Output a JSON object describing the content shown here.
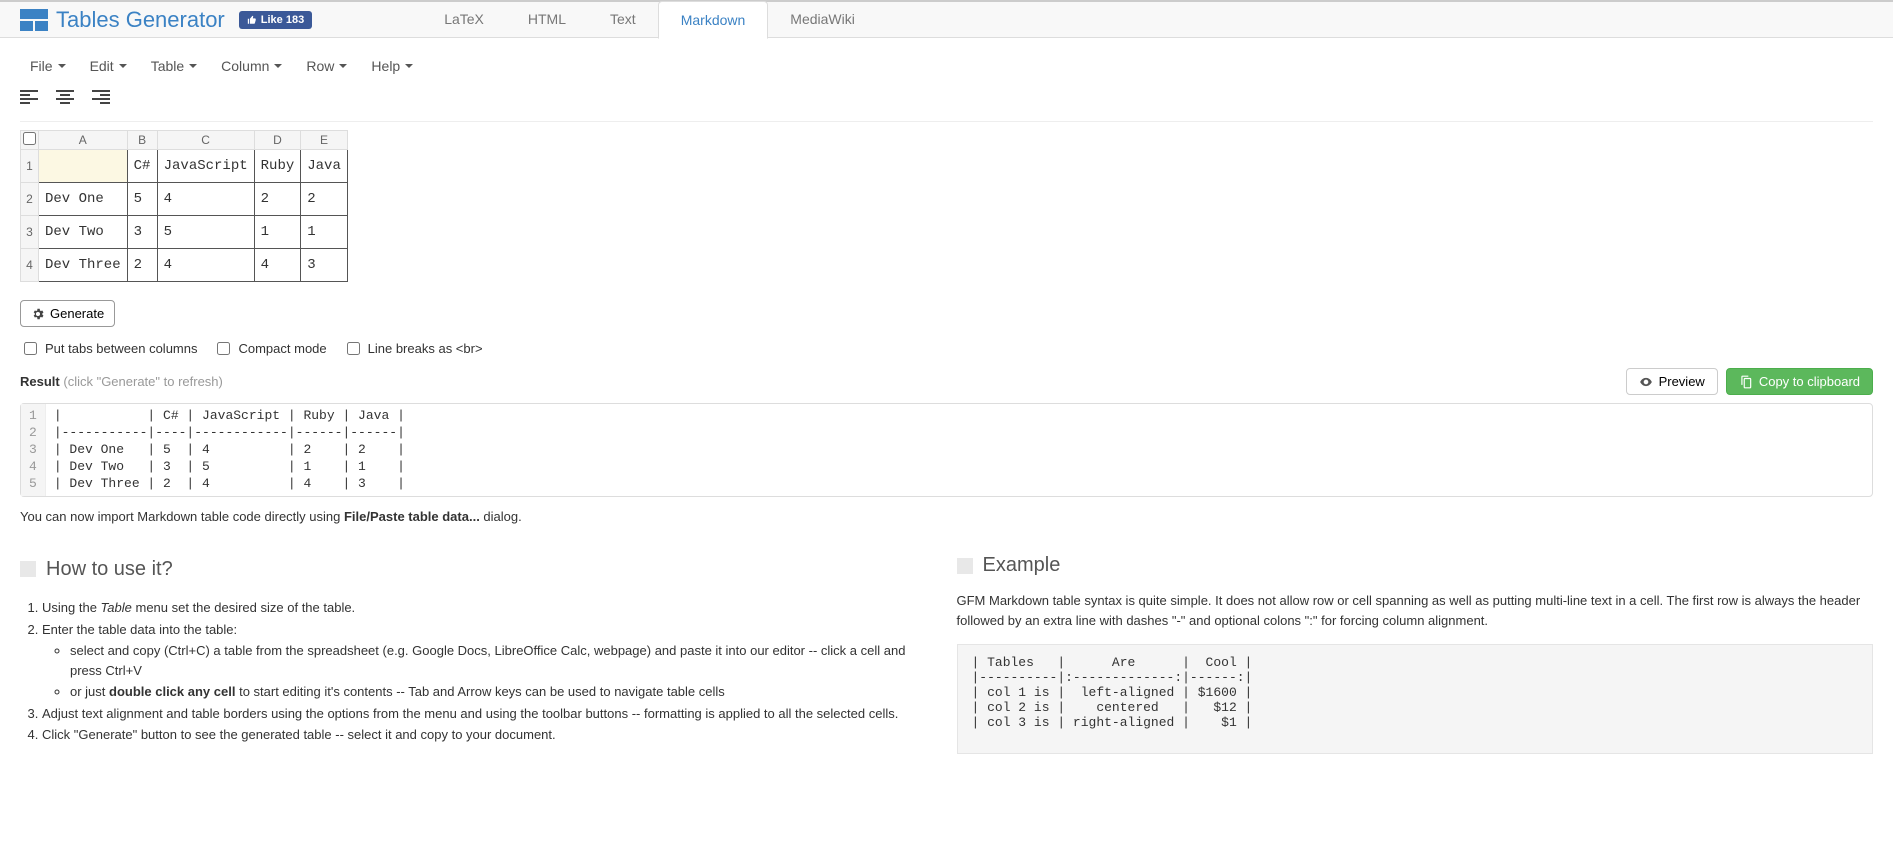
{
  "logo_text": "Tables Generator",
  "fb_like": "Like 183",
  "tabs": [
    "LaTeX",
    "HTML",
    "Text",
    "Markdown",
    "MediaWiki"
  ],
  "tab_active": 3,
  "menus": [
    "File",
    "Edit",
    "Table",
    "Column",
    "Row",
    "Help"
  ],
  "grid": {
    "cols": [
      "A",
      "B",
      "C",
      "D",
      "E"
    ],
    "rows": [
      "1",
      "2",
      "3",
      "4"
    ],
    "cells": [
      [
        "",
        "C#",
        "JavaScript",
        "Ruby",
        "Java"
      ],
      [
        "Dev One",
        "5",
        "4",
        "2",
        "2"
      ],
      [
        "Dev Two",
        "3",
        "5",
        "1",
        "1"
      ],
      [
        "Dev Three",
        "2",
        "4",
        "4",
        "3"
      ]
    ],
    "selected": [
      0,
      0
    ]
  },
  "generate_label": "Generate",
  "opts": {
    "tabs_label": "Put tabs between columns",
    "compact_label": "Compact mode",
    "br_label": "Line breaks as <br>"
  },
  "result": {
    "label": "Result",
    "hint": "(click \"Generate\" to refresh)",
    "preview": "Preview",
    "copy": "Copy to clipboard"
  },
  "code_lines": [
    "|           | C# | JavaScript | Ruby | Java |",
    "|-----------|----|------------|------|------|",
    "| Dev One   | 5  | 4          | 2    | 2    |",
    "| Dev Two   | 3  | 5          | 1    | 1    |",
    "| Dev Three | 2  | 4          | 4    | 3    |"
  ],
  "import_prefix": "You can now import Markdown table code directly using ",
  "import_bold": "File/Paste table data...",
  "import_suffix": " dialog.",
  "howto_heading": "How to use it?",
  "howto": {
    "li1_a": "Using the ",
    "li1_em": "Table",
    "li1_b": " menu set the desired size of the table.",
    "li2": "Enter the table data into the table:",
    "li2a": "select and copy (Ctrl+C) a table from the spreadsheet (e.g. Google Docs, LibreOffice Calc, webpage) and paste it into our editor -- click a cell and press Ctrl+V",
    "li2b_a": "or just ",
    "li2b_bold": "double click any cell",
    "li2b_b": " to start editing it's contents -- Tab and Arrow keys can be used to navigate table cells",
    "li3": "Adjust text alignment and table borders using the options from the menu and using the toolbar buttons -- formatting is applied to all the selected cells.",
    "li4": "Click \"Generate\" button to see the generated table -- select it and copy to your document."
  },
  "example_heading": "Example",
  "example_text": "GFM Markdown table syntax is quite simple. It does not allow row or cell spanning as well as putting multi-line text in a cell. The first row is always the header followed by an extra line with dashes \"-\" and optional colons \":\" for forcing column alignment.",
  "example_code": "| Tables   |      Are      |  Cool |\n|----------|:-------------:|------:|\n| col 1 is |  left-aligned | $1600 |\n| col 2 is |    centered   |   $12 |\n| col 3 is | right-aligned |    $1 |"
}
